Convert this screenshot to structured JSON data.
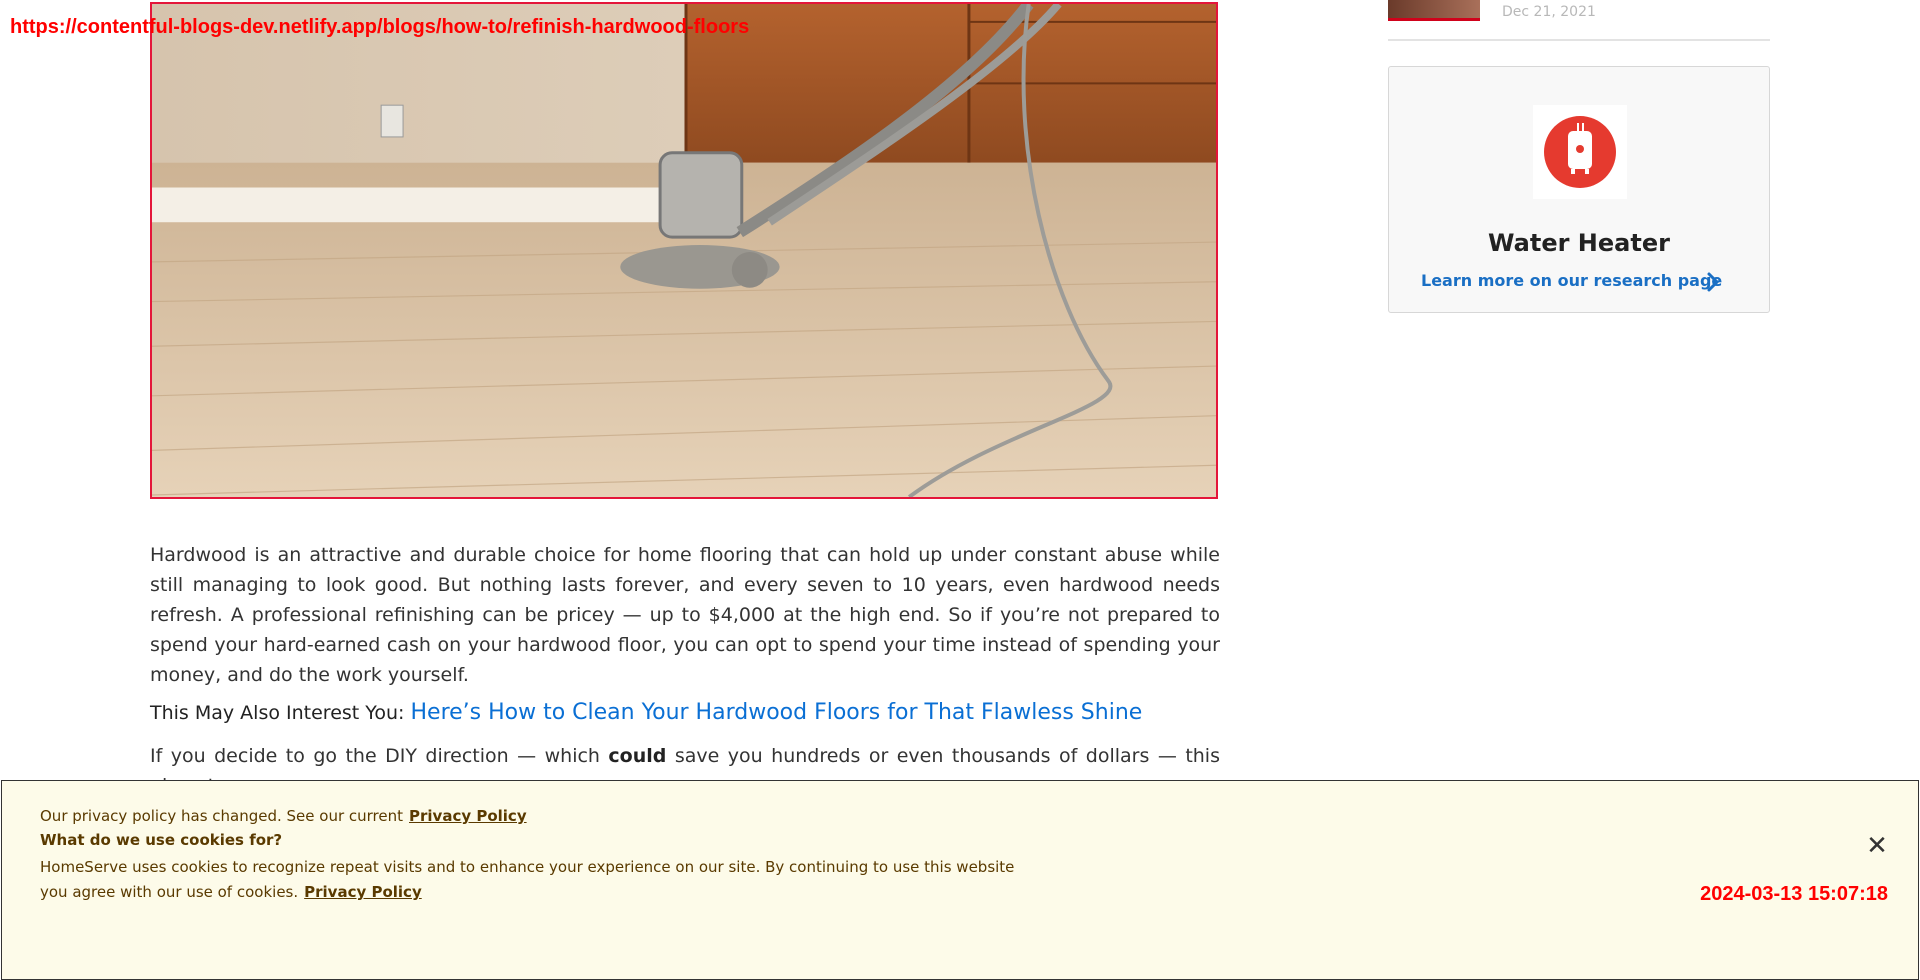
{
  "browser": {
    "url": "https://contentful-blogs-dev.netlify.app/blogs/how-to/refinish-hardwood-floors",
    "timestamp": "2024-03-13 15:07:18"
  },
  "hero": {
    "alt": "floor sander on hardwood floor"
  },
  "article": {
    "intro": "Hardwood is an attractive and durable choice for home flooring that can hold up under constant abuse while still managing to look good. But nothing lasts forever, and every seven to 10 years, even hardwood needs refresh. A professional refinishing can be pricey — up to $4,000 at the high end. So if you’re not prepared to spend your hard-earned cash on your hardwood floor, you can opt to spend your time instead of spending your money, and do the work yourself.",
    "interest_label": "This May Also Interest You:",
    "interest_link": "Here’s How to Clean Your Hardwood Floors for That Flawless Shine",
    "diy_before": "If you decide to go the DIY direction — which ",
    "diy_bold": "could",
    "diy_after": " save you hundreds or even thousands of dollars — this nine-step"
  },
  "sidebar": {
    "date": "Dec 21, 2021",
    "card": {
      "icon": "water-heater-icon",
      "title": "Water Heater",
      "link": "Learn more on our research page"
    }
  },
  "cookie": {
    "line1": "Our privacy policy has changed. See our current",
    "privacy_link": "Privacy Policy",
    "line2": "What do we use cookies for?",
    "line3": "HomeServe uses cookies to recognize repeat visits and to enhance your experience on our site. By continuing to use this website you agree with our use of cookies.",
    "privacy_link2": "Privacy Policy",
    "close": "✕"
  },
  "colors": {
    "accent_red": "#e4163a",
    "link_blue": "#0a6fd4",
    "icon_red": "#e53a2f",
    "cookie_bg": "#fdfbe9"
  }
}
